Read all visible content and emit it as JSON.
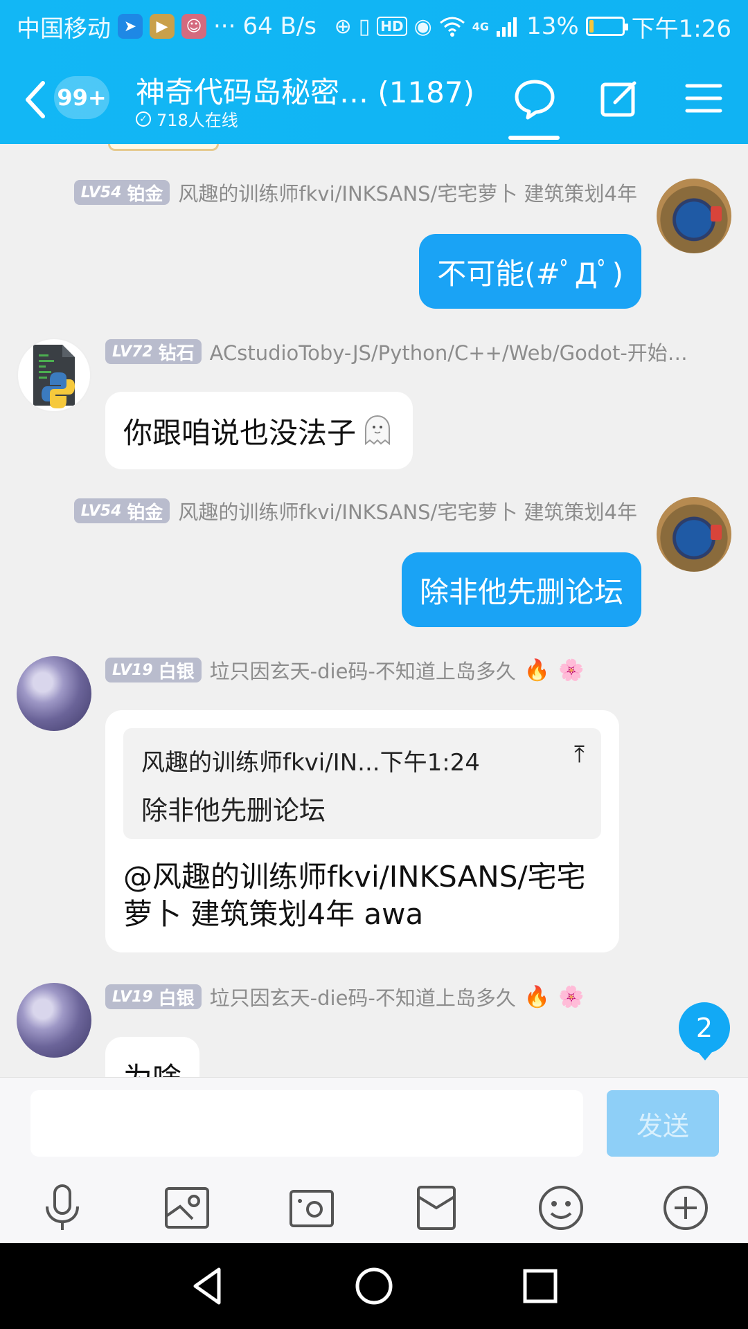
{
  "status_bar": {
    "carrier": "中国移动",
    "speed": "64 B/s",
    "hd": "HD",
    "network": "4G",
    "battery_pct": "13%",
    "battery_level": 0.13,
    "time": "下午1:26"
  },
  "header": {
    "unread_badge": "99+",
    "title": "神奇代码岛秘密… (1187)",
    "online": "718人在线"
  },
  "messages": [
    {
      "level": "54",
      "rank": "铂金",
      "sender": "风趣的训练师fkvi/INKSANS/宅宅萝卜 建筑策划4年",
      "text": "不可能(#ﾟДﾟ)"
    },
    {
      "level": "72",
      "rank": "钻石",
      "sender": "ACstudioToby-JS/Python/C++/Web/Godot-开始…",
      "text": "你跟咱说也没法子"
    },
    {
      "level": "54",
      "rank": "铂金",
      "sender": "风趣的训练师fkvi/INKSANS/宅宅萝卜 建筑策划4年",
      "text": "除非他先删论坛"
    },
    {
      "level": "19",
      "rank": "白银",
      "sender": "垃只因玄天-die码-不知道上岛多久",
      "quote_header": "风趣的训练师fkvi/IN...下午1:24",
      "quote_text": "除非他先删论坛",
      "text": "@风趣的训练师fkvi/INKSANS/宅宅萝卜 建筑策划4年 awa"
    },
    {
      "level": "19",
      "rank": "白银",
      "sender": "垃只因玄天-die码-不知道上岛多久",
      "text": "为啥"
    }
  ],
  "lv_prefix": "LV",
  "new_message_count": "2",
  "input": {
    "value": "",
    "send_label": "发送"
  },
  "colors": {
    "header": "#12b7f5",
    "my_bubble": "#1aa3f5",
    "level_badge": "#b9bccd",
    "send_disabled": "#8ecff7"
  }
}
